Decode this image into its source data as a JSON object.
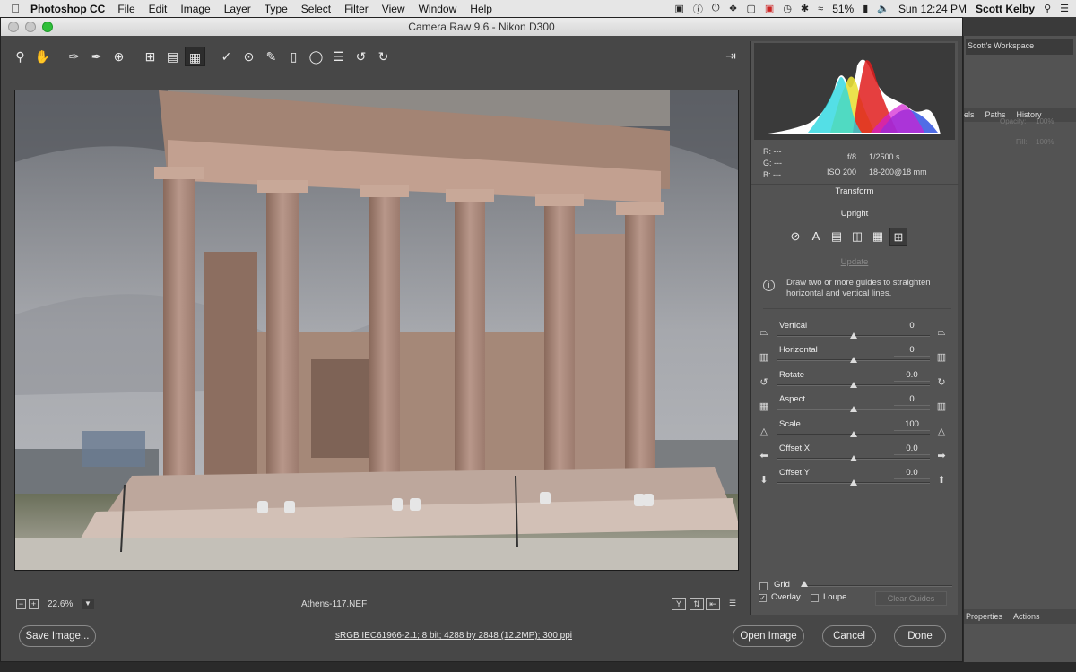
{
  "menubar": {
    "app": "Photoshop CC",
    "items": [
      "File",
      "Edit",
      "Image",
      "Layer",
      "Type",
      "Select",
      "Filter",
      "View",
      "Window",
      "Help"
    ],
    "battery": "51%",
    "clock": "Sun 12:24 PM",
    "user": "Scott Kelby"
  },
  "ps_panels": {
    "workspace": "Scott's Workspace",
    "tabs_top": [
      "els",
      "Paths",
      "History"
    ],
    "tabs_bottom": [
      "Properties",
      "Actions"
    ],
    "opacity_label": "Opacity:",
    "opacity_value": "100%",
    "fill_label": "Fill:",
    "fill_value": "100%"
  },
  "window": {
    "title": "Camera Raw 9.6  -  Nikon D300"
  },
  "exif": {
    "r": "R:  ---",
    "g": "G:  ---",
    "b": "B:  ---",
    "aperture": "f/8",
    "shutter": "1/2500 s",
    "iso": "ISO 200",
    "lens": "18-200@18 mm"
  },
  "transform": {
    "title": "Transform",
    "upright_label": "Upright",
    "update_link": "Update",
    "info": "Draw two or more guides to straighten horizontal and vertical lines.",
    "sliders": [
      {
        "label": "Vertical",
        "value": "0",
        "icon_l": "vertical-left-icon",
        "icon_r": "vertical-right-icon",
        "pos": 0.5
      },
      {
        "label": "Horizontal",
        "value": "0",
        "icon_l": "horizontal-left-icon",
        "icon_r": "horizontal-right-icon",
        "pos": 0.5
      },
      {
        "label": "Rotate",
        "value": "0.0",
        "icon_l": "rotate-ccw-icon",
        "icon_r": "rotate-cw-icon",
        "pos": 0.5
      },
      {
        "label": "Aspect",
        "value": "0",
        "icon_l": "aspect-left-icon",
        "icon_r": "aspect-right-icon",
        "pos": 0.5
      },
      {
        "label": "Scale",
        "value": "100",
        "icon_l": "scale-down-icon",
        "icon_r": "scale-up-icon",
        "pos": 0.5
      },
      {
        "label": "Offset X",
        "value": "0.0",
        "icon_l": "arrow-left-icon",
        "icon_r": "arrow-right-icon",
        "pos": 0.5
      },
      {
        "label": "Offset Y",
        "value": "0.0",
        "icon_l": "arrow-down-icon",
        "icon_r": "arrow-up-icon",
        "pos": 0.5
      }
    ],
    "grid_label": "Grid",
    "overlay_label": "Overlay",
    "loupe_label": "Loupe",
    "clear_guides": "Clear Guides"
  },
  "status": {
    "zoom": "22.6%",
    "filename": "Athens-117.NEF",
    "workflow": "sRGB IEC61966-2.1; 8 bit; 4288 by 2848 (12.2MP); 300 ppi"
  },
  "buttons": {
    "save": "Save Image...",
    "open": "Open Image",
    "cancel": "Cancel",
    "done": "Done"
  }
}
